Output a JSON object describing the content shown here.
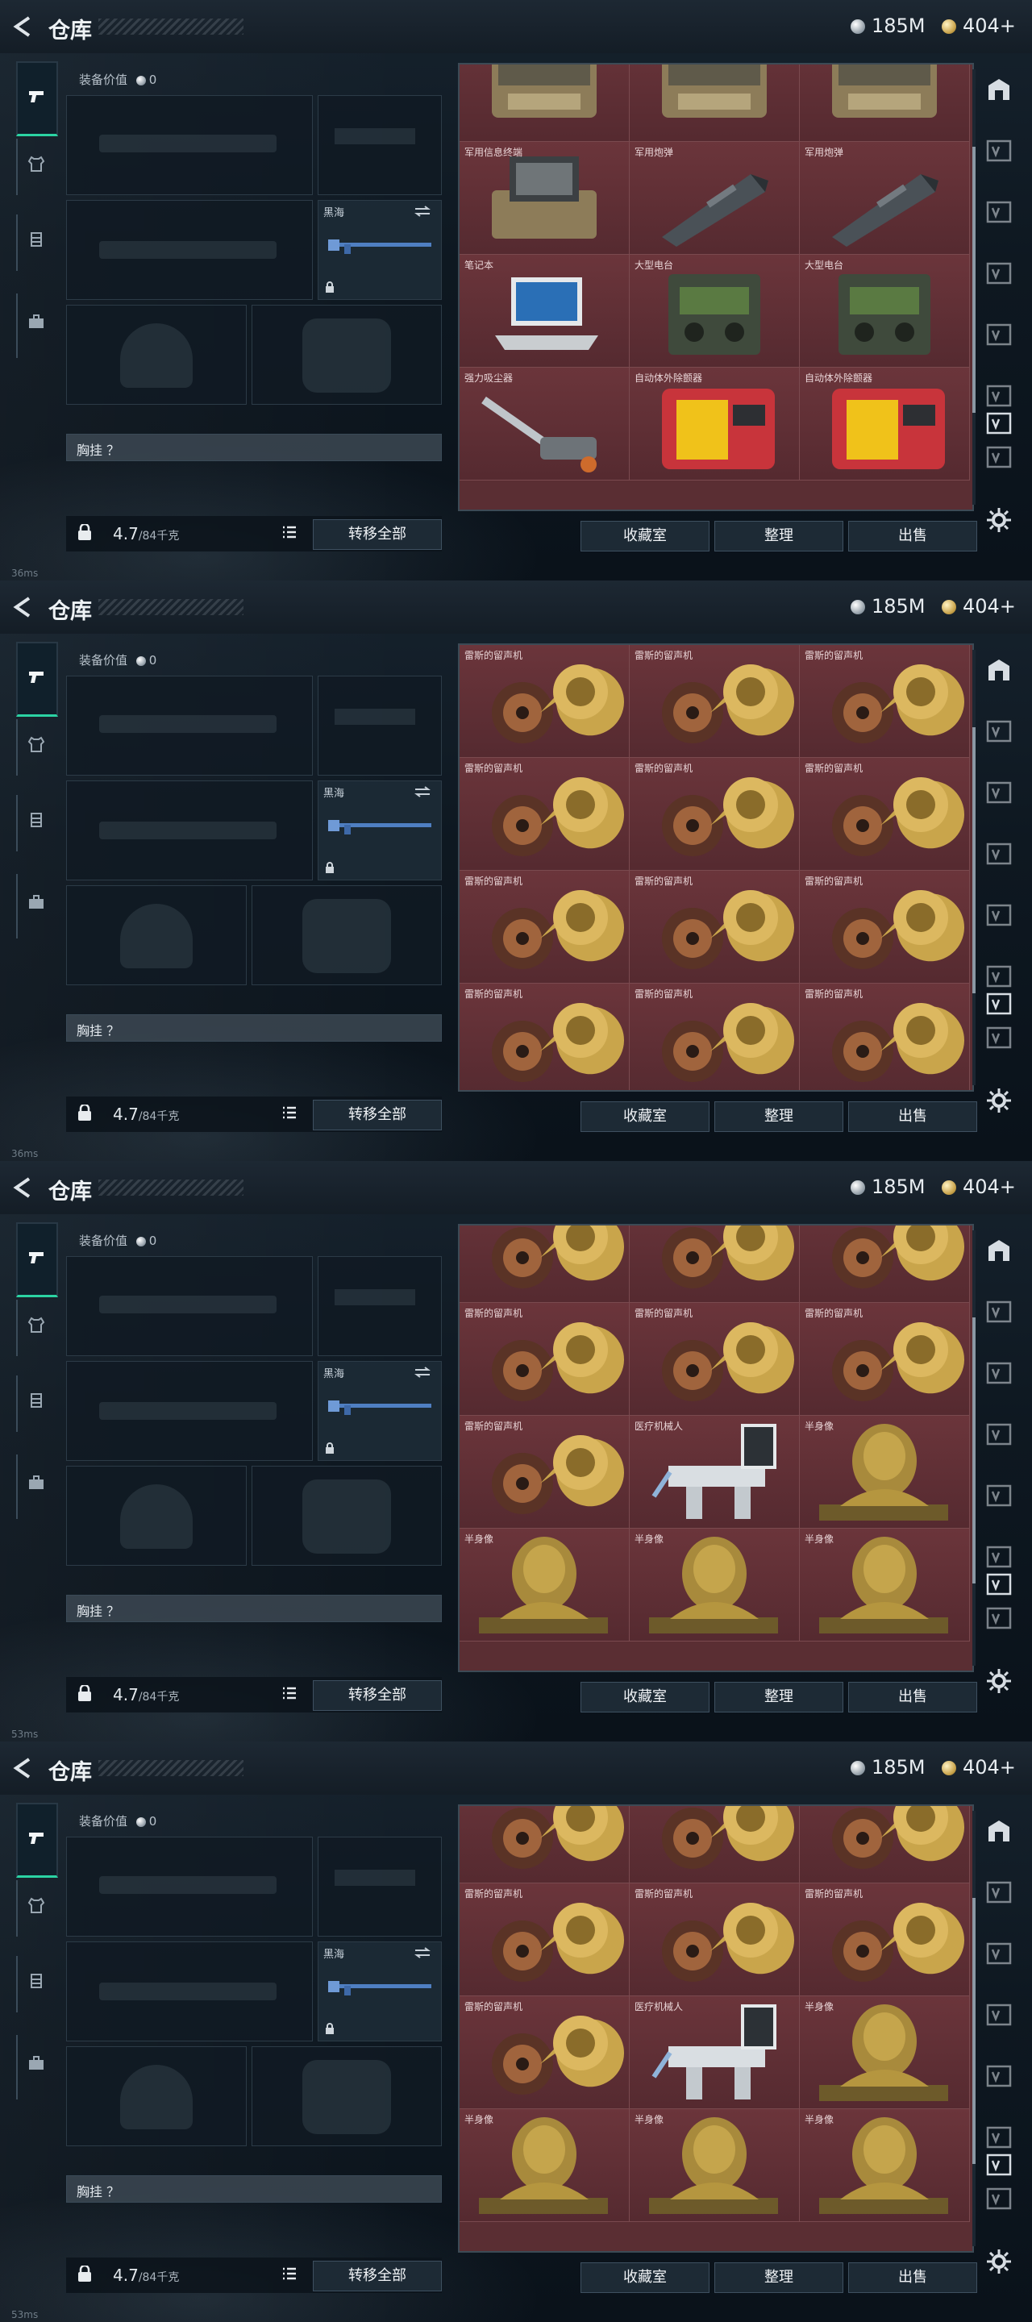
{
  "header": {
    "title": "仓库",
    "silver": "185M",
    "gold": "404+"
  },
  "equipment": {
    "value_label": "装备价值",
    "value": "0",
    "secondary_weapon_name": "黑海",
    "chest_rig_label": "胸挂 ？",
    "weight_value": "4.7",
    "weight_max": "/84千克",
    "transfer_all": "转移全部"
  },
  "actions": {
    "collection": "收藏室",
    "sort": "整理",
    "sell": "出售"
  },
  "panels": [
    {
      "status": "36ms",
      "scroll_thumb_fraction": 0.32,
      "rows": [
        [
          {
            "label": "",
            "icon": "crate-icon"
          },
          {
            "label": "",
            "icon": "crate-icon"
          },
          {
            "label": "",
            "icon": "crate-icon"
          }
        ],
        [
          {
            "label": "军用信息终端",
            "icon": "terminal-icon"
          },
          {
            "label": "军用炮弹",
            "icon": "shell-icon"
          },
          {
            "label": "军用炮弹",
            "icon": "shell-icon"
          }
        ],
        [
          {
            "label": "笔记本",
            "icon": "laptop-icon"
          },
          {
            "label": "大型电台",
            "icon": "radio-icon"
          },
          {
            "label": "大型电台",
            "icon": "radio-icon"
          }
        ],
        [
          {
            "label": "强力吸尘器",
            "icon": "vacuum-icon"
          },
          {
            "label": "自动体外除颤器",
            "icon": "defibrillator-icon"
          },
          {
            "label": "自动体外除颤器",
            "icon": "defibrillator-icon"
          }
        ]
      ]
    },
    {
      "status": "36ms",
      "scroll_thumb_fraction": 0.32,
      "rows": [
        [
          {
            "label": "雷斯的留声机",
            "icon": "gramophone-icon"
          },
          {
            "label": "雷斯的留声机",
            "icon": "gramophone-icon"
          },
          {
            "label": "雷斯的留声机",
            "icon": "gramophone-icon"
          }
        ],
        [
          {
            "label": "雷斯的留声机",
            "icon": "gramophone-icon"
          },
          {
            "label": "雷斯的留声机",
            "icon": "gramophone-icon"
          },
          {
            "label": "雷斯的留声机",
            "icon": "gramophone-icon"
          }
        ],
        [
          {
            "label": "雷斯的留声机",
            "icon": "gramophone-icon"
          },
          {
            "label": "雷斯的留声机",
            "icon": "gramophone-icon"
          },
          {
            "label": "雷斯的留声机",
            "icon": "gramophone-icon"
          }
        ],
        [
          {
            "label": "雷斯的留声机",
            "icon": "gramophone-icon"
          },
          {
            "label": "雷斯的留声机",
            "icon": "gramophone-icon"
          },
          {
            "label": "雷斯的留声机",
            "icon": "gramophone-icon"
          }
        ]
      ]
    },
    {
      "status": "53ms",
      "scroll_thumb_fraction": 0.36,
      "rows": [
        [
          {
            "label": "",
            "icon": "gramophone-icon"
          },
          {
            "label": "",
            "icon": "gramophone-icon"
          },
          {
            "label": "",
            "icon": "gramophone-icon"
          }
        ],
        [
          {
            "label": "雷斯的留声机",
            "icon": "gramophone-icon"
          },
          {
            "label": "雷斯的留声机",
            "icon": "gramophone-icon"
          },
          {
            "label": "雷斯的留声机",
            "icon": "gramophone-icon"
          }
        ],
        [
          {
            "label": "雷斯的留声机",
            "icon": "gramophone-icon"
          },
          {
            "label": "医疗机械人",
            "icon": "robot-arm-icon"
          },
          {
            "label": "半身像",
            "icon": "bust-icon"
          }
        ],
        [
          {
            "label": "半身像",
            "icon": "bust-icon"
          },
          {
            "label": "半身像",
            "icon": "bust-icon"
          },
          {
            "label": "半身像",
            "icon": "bust-icon"
          }
        ]
      ]
    },
    {
      "status": "53ms",
      "scroll_thumb_fraction": 0.36,
      "rows": [
        [
          {
            "label": "",
            "icon": "gramophone-icon"
          },
          {
            "label": "",
            "icon": "gramophone-icon"
          },
          {
            "label": "",
            "icon": "gramophone-icon"
          }
        ],
        [
          {
            "label": "雷斯的留声机",
            "icon": "gramophone-icon"
          },
          {
            "label": "雷斯的留声机",
            "icon": "gramophone-icon"
          },
          {
            "label": "雷斯的留声机",
            "icon": "gramophone-icon"
          }
        ],
        [
          {
            "label": "雷斯的留声机",
            "icon": "gramophone-icon"
          },
          {
            "label": "医疗机械人",
            "icon": "robot-arm-icon"
          },
          {
            "label": "半身像",
            "icon": "bust-icon"
          }
        ],
        [
          {
            "label": "半身像",
            "icon": "bust-icon"
          },
          {
            "label": "半身像",
            "icon": "bust-icon"
          },
          {
            "label": "半身像",
            "icon": "bust-icon"
          }
        ]
      ]
    }
  ]
}
